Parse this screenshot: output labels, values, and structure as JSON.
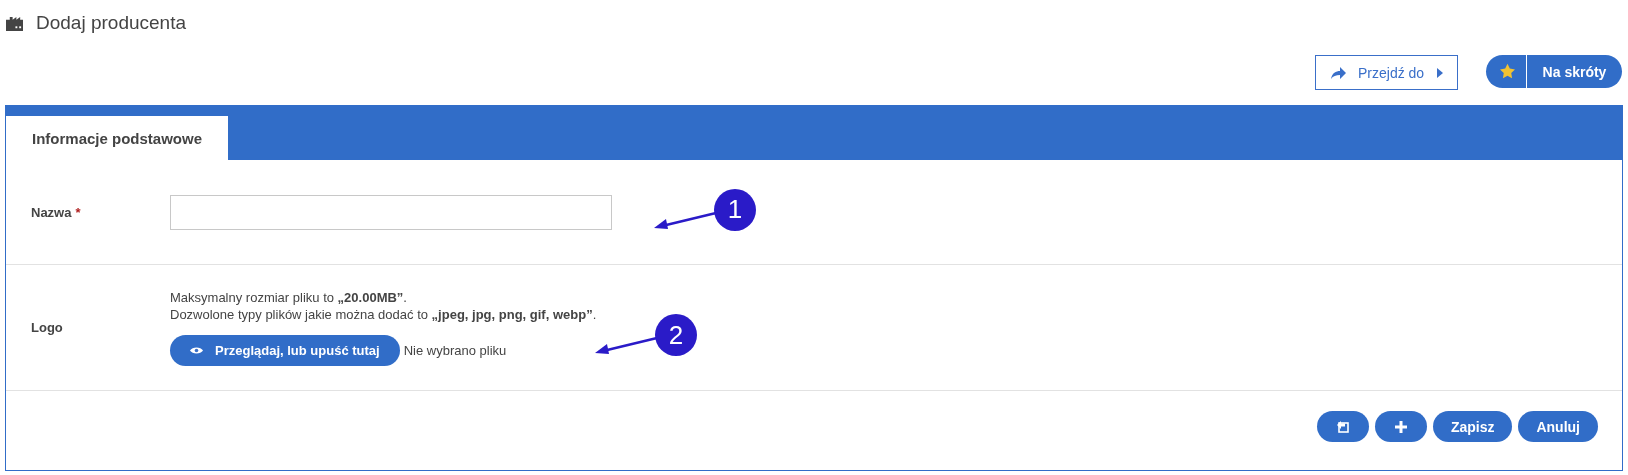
{
  "page": {
    "title": "Dodaj producenta"
  },
  "header_buttons": [
    {
      "kind": "goto",
      "label": "Przejdź do"
    },
    {
      "kind": "shortcuts",
      "label": "Na skróty"
    }
  ],
  "tabs": [
    {
      "label": "Informacje podstawowe",
      "selected": true
    }
  ],
  "fields": [
    {
      "kind": "text",
      "label": "Nazwa",
      "required_mark": "*",
      "callout": "1"
    },
    {
      "kind": "file",
      "label": "Logo",
      "hint_lines": [
        "Maksymalny rozmiar pliku to **„20.00MB”**.",
        "Dozwolone typy plików jakie można dodać to **„jpeg, jpg, png, gif, webp”**."
      ],
      "button": "Przeglądaj, lub upuść tutaj",
      "status": "Nie wybrano pliku",
      "callout": "2"
    }
  ],
  "footer_buttons": [
    {
      "kind": "back"
    },
    {
      "kind": "add"
    },
    {
      "kind": "text",
      "label": "Zapisz"
    },
    {
      "kind": "text",
      "label": "Anuluj"
    }
  ]
}
